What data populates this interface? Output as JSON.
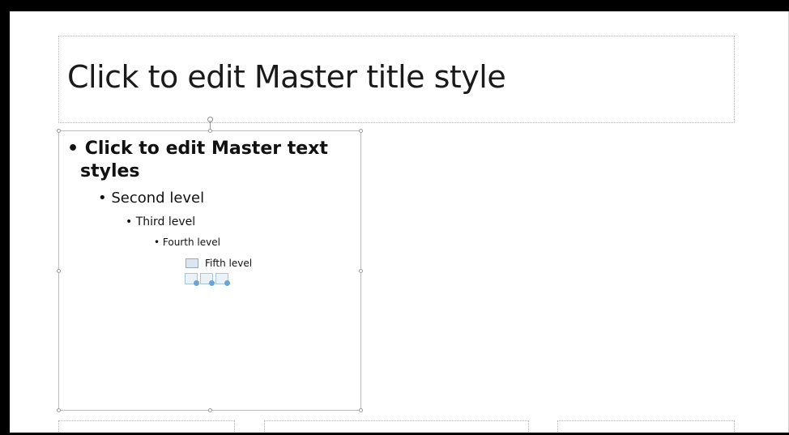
{
  "slide": {
    "title_placeholder": {
      "text": "Click to edit Master title style"
    },
    "body_placeholder": {
      "level1_line1": "Click to edit Master text",
      "level1_line2": "styles",
      "level2": "Second level",
      "level3": "Third level",
      "level4": "Fourth level",
      "level5": "Fifth level",
      "bullet": "•",
      "insert_icons": [
        "picture-icon",
        "online-picture-icon",
        "video-icon"
      ]
    },
    "footer_placeholders": [
      "date-placeholder",
      "footer-placeholder",
      "slide-number-placeholder"
    ]
  }
}
